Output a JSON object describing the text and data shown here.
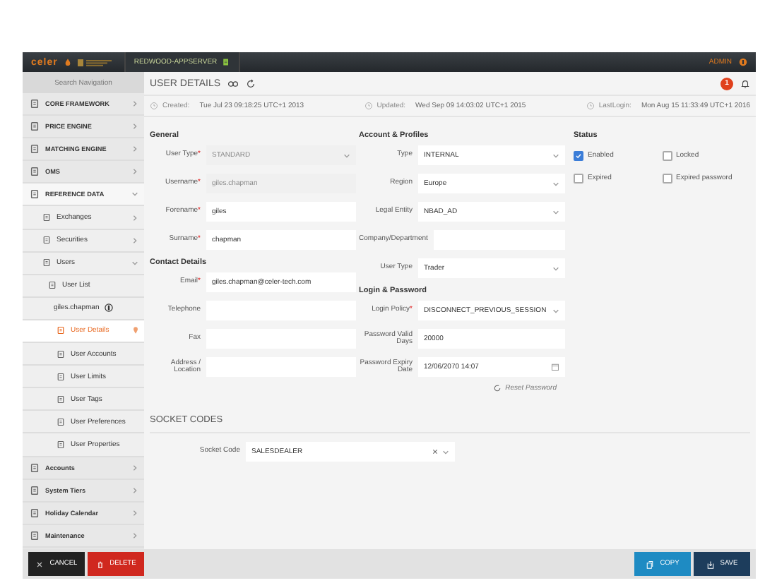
{
  "topbar": {
    "logo": "celer",
    "server": "REDWOOD-APPSERVER",
    "user": "ADMIN"
  },
  "sidebar": {
    "search": {
      "placeholder": "Search Navigation"
    },
    "items": [
      {
        "label": "CORE FRAMEWORK",
        "expanded": false,
        "selected": false
      },
      {
        "label": "PRICE ENGINE",
        "expanded": false,
        "selected": false
      },
      {
        "label": "MATCHING ENGINE",
        "expanded": false,
        "selected": false
      },
      {
        "label": "OMS",
        "expanded": false,
        "selected": false
      },
      {
        "label": "REFERENCE DATA",
        "expanded": true,
        "selected": false,
        "children": [
          {
            "label": "Exchanges",
            "expanded": false,
            "selected": false
          },
          {
            "label": "Securities",
            "expanded": false,
            "selected": false
          },
          {
            "label": "Users",
            "expanded": true,
            "selected": false,
            "children": [
              {
                "label": "User List",
                "selected": false
              },
              {
                "label": "giles.chapman",
                "selected": false,
                "children": [
                  {
                    "label": "User Details",
                    "selected": true
                  },
                  {
                    "label": "User Accounts",
                    "selected": false
                  },
                  {
                    "label": "User Limits",
                    "selected": false
                  },
                  {
                    "label": "User Tags",
                    "selected": false
                  },
                  {
                    "label": "User Preferences",
                    "selected": false
                  },
                  {
                    "label": "User Properties",
                    "selected": false
                  }
                ]
              }
            ]
          }
        ]
      },
      {
        "label": "Accounts",
        "expanded": false,
        "selected": false
      },
      {
        "label": "System Tiers",
        "expanded": false,
        "selected": false
      },
      {
        "label": "Holiday Calendar",
        "expanded": false,
        "selected": false
      },
      {
        "label": "Maintenance",
        "expanded": false,
        "selected": false
      }
    ]
  },
  "header": {
    "title": "USER DETAILS",
    "notifications": "1"
  },
  "meta": [
    {
      "label": "Created:",
      "value": "Tue Jul 23 09:18:25 UTC+1 2013"
    },
    {
      "label": "Updated:",
      "value": "Wed Sep 09 14:03:02 UTC+1 2015"
    },
    {
      "label": "LastLogin:",
      "value": "Mon Aug 15 11:33:49 UTC+1 2016"
    }
  ],
  "general": {
    "heading": "General",
    "fields": [
      {
        "label": "User Type",
        "mark": "*",
        "kind": "select",
        "value": "STANDARD",
        "disabled": true
      },
      {
        "label": "Username",
        "mark": "*",
        "kind": "text",
        "value": "giles.chapman",
        "disabled": true
      },
      {
        "label": "Forename",
        "mark": "*",
        "kind": "text",
        "value": "giles",
        "disabled": false
      },
      {
        "label": "Surname",
        "mark": "*",
        "kind": "text",
        "value": "chapman",
        "disabled": false
      }
    ]
  },
  "contact_details": {
    "heading": "Contact Details",
    "fields": [
      {
        "label": "Email",
        "mark": "*",
        "kind": "text",
        "value": "giles.chapman@celer-tech.com",
        "disabled": false
      },
      {
        "label": "Telephone",
        "kind": "text",
        "disabled": false
      },
      {
        "label": "Fax",
        "kind": "text",
        "disabled": false
      },
      {
        "label": "Address / Location",
        "kind": "text",
        "disabled": false
      }
    ]
  },
  "account_profiles": {
    "heading": "Account & Profiles",
    "fields": [
      {
        "label": "Type",
        "kind": "select",
        "value": "INTERNAL",
        "disabled": false
      },
      {
        "label": "Region",
        "kind": "select",
        "value": "Europe",
        "disabled": false
      },
      {
        "label": "Legal Entity",
        "kind": "select",
        "value": "NBAD_AD",
        "disabled": false
      },
      {
        "label": "Company/Department",
        "kind": "text",
        "disabled": false
      },
      {
        "label": "User Type",
        "kind": "select",
        "value": "Trader",
        "disabled": false
      }
    ]
  },
  "login_password": {
    "heading": "Login & Password",
    "fields": [
      {
        "label": "Login Policy",
        "mark": "*",
        "kind": "select",
        "value": "DISCONNECT_PREVIOUS_SESSION",
        "disabled": false
      },
      {
        "label": "Password Valid Days",
        "kind": "text",
        "value": "20000",
        "disabled": false
      },
      {
        "label": "Password Expiry Date",
        "kind": "date",
        "value": "12/06/2070 14:07",
        "disabled": false
      }
    ]
  },
  "reset_password": "Reset Password",
  "status": {
    "heading": "Status",
    "checkboxes": [
      {
        "label": "Enabled",
        "checked": true
      },
      {
        "label": "Expired",
        "checked": false
      },
      {
        "label": "Locked",
        "checked": false
      },
      {
        "label": "Expired password",
        "checked": false
      }
    ]
  },
  "socket_codes": {
    "heading": "SOCKET CODES",
    "label": "Socket Code",
    "value": "SALESDEALER"
  },
  "footer": [
    {
      "label": "CANCEL",
      "kind": "cancel"
    },
    {
      "label": "DELETE",
      "kind": "delete"
    },
    {
      "label": "COPY",
      "kind": "copy"
    },
    {
      "label": "SAVE",
      "kind": "save"
    }
  ]
}
